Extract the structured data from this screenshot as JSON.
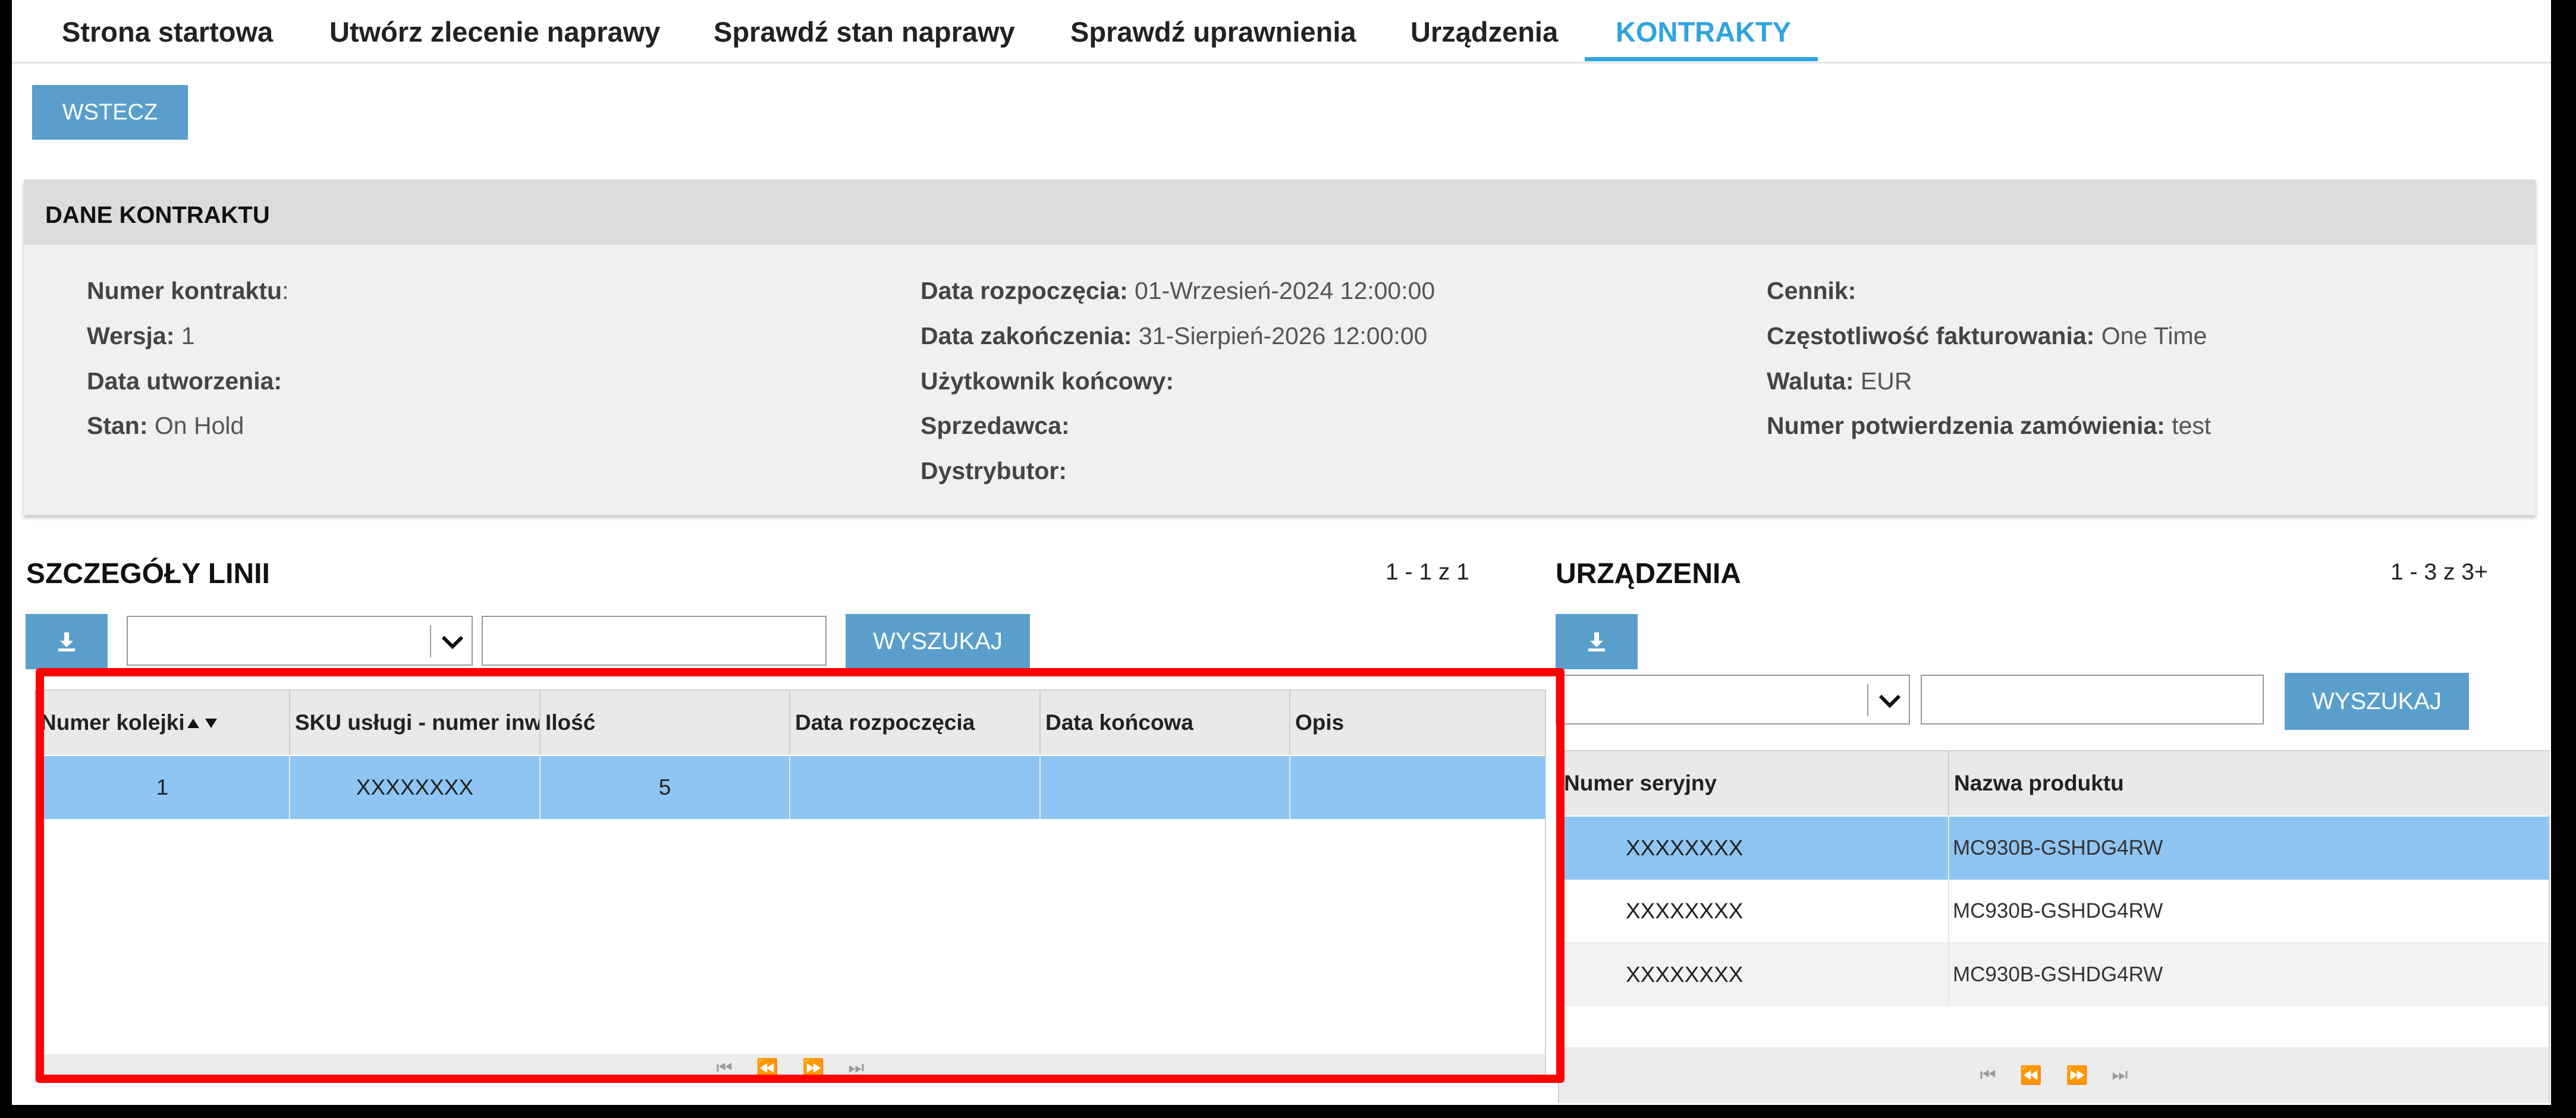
{
  "nav": {
    "tabs": [
      {
        "label": "Strona startowa"
      },
      {
        "label": "Utwórz zlecenie naprawy"
      },
      {
        "label": "Sprawdź stan naprawy"
      },
      {
        "label": "Sprawdź uprawnienia"
      },
      {
        "label": "Urządzenia"
      },
      {
        "label": "KONTRAKTY",
        "active": true
      }
    ]
  },
  "back_label": "WSTECZ",
  "contract": {
    "title": "DANE KONTRAKTU",
    "col1": [
      {
        "label": "Numer kontraktu",
        "sep": ":",
        "value": ""
      },
      {
        "label": "Wersja:",
        "sep": "",
        "value": " 1"
      },
      {
        "label": "Data utworzenia:",
        "sep": "",
        "value": ""
      },
      {
        "label": "Stan:",
        "sep": "",
        "value": " On Hold"
      }
    ],
    "col2": [
      {
        "label": "Data rozpoczęcia:",
        "sep": "",
        "value": " 01-Wrzesień-2024 12:00:00"
      },
      {
        "label": "Data zakończenia:",
        "sep": "",
        "value": " 31-Sierpień-2026 12:00:00"
      },
      {
        "label": "Użytkownik końcowy:",
        "sep": "",
        "value": ""
      },
      {
        "label": "Sprzedawca:",
        "sep": "",
        "value": ""
      },
      {
        "label": "Dystrybutor:",
        "sep": "",
        "value": ""
      }
    ],
    "col3": [
      {
        "label": "Cennik:",
        "sep": "",
        "value": ""
      },
      {
        "label": "Częstotliwość fakturowania:",
        "sep": "",
        "value": " One Time"
      },
      {
        "label": "Waluta:",
        "sep": "",
        "value": " EUR"
      },
      {
        "label": "Numer potwierdzenia zamówienia:",
        "sep": "",
        "value": " test"
      }
    ]
  },
  "lines": {
    "title": "SZCZEGÓŁY LINII",
    "pager": "1 - 1 z 1",
    "search_label": "WYSZUKAJ",
    "columns": [
      "Numer kolejki",
      "SKU usługi - numer inw",
      "Ilość",
      "Data rozpoczęcia",
      "Data końcowa",
      "Opis"
    ],
    "sort_icon": "sort-up-down-icon",
    "rows": [
      {
        "seq": "1",
        "sku": "XXXXXXXX",
        "qty": "5",
        "start": "",
        "end": "",
        "desc": ""
      }
    ]
  },
  "devices": {
    "title": "URZĄDZENIA",
    "pager": "1 - 3 z 3+",
    "search_label": "WYSZUKAJ",
    "columns": [
      "Numer seryjny",
      "Nazwa produktu"
    ],
    "rows": [
      {
        "serial": "XXXXXXXX",
        "product": "MC930B-GSHDG4RW"
      },
      {
        "serial": "XXXXXXXX",
        "product": "MC930B-GSHDG4RW"
      },
      {
        "serial": "XXXXXXXX",
        "product": "MC930B-GSHDG4RW"
      }
    ]
  },
  "colors": {
    "accent": "#2fa4de",
    "button": "#5a9fcb",
    "selected_row": "#8ec5f2",
    "highlight": "#ff0000"
  }
}
